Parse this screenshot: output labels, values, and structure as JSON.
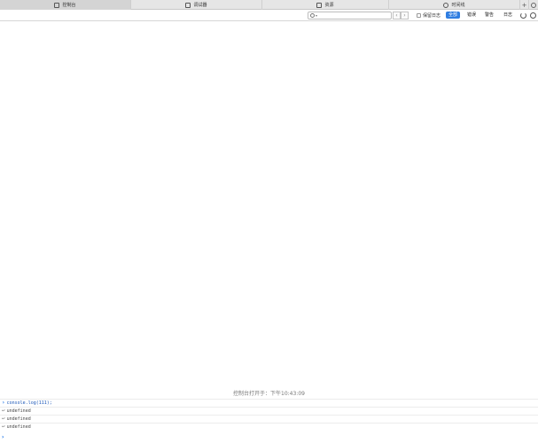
{
  "tabs": [
    {
      "label": "控制台",
      "icon": "console-icon",
      "active": true
    },
    {
      "label": "调试器",
      "icon": "debugger-icon",
      "active": false
    },
    {
      "label": "资源",
      "icon": "resources-icon",
      "active": false
    },
    {
      "label": "时间线",
      "icon": "timeline-icon",
      "active": false
    }
  ],
  "tab_actions": {
    "add": "+"
  },
  "toolbar": {
    "search_caret": "▾",
    "nav_prev": "‹",
    "nav_next": "›",
    "preserve_log_label": "保留日志",
    "preserve_log_checked": false,
    "filters": [
      "全部",
      "错误",
      "警告",
      "日志"
    ],
    "active_filter": "全部"
  },
  "console": {
    "opened_message": "控制台打开于：下午10:43:09",
    "entries": [
      {
        "type": "input",
        "text": "console.log(111);"
      },
      {
        "type": "output",
        "text": "undefined"
      },
      {
        "type": "output",
        "text": "undefined"
      },
      {
        "type": "output",
        "text": "undefined"
      }
    ],
    "prompt": "›"
  },
  "colors": {
    "accent": "#2f7de1",
    "command": "#1a56b8"
  }
}
